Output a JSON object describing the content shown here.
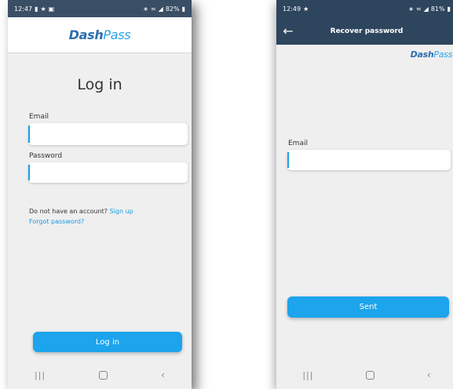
{
  "left_screen": {
    "status": {
      "time": "12:47",
      "battery": "82%"
    },
    "logo": {
      "dash": "Dash",
      "pass": "Pass"
    },
    "title": "Log in",
    "email": {
      "label": "Email",
      "value": ""
    },
    "password": {
      "label": "Password",
      "value": ""
    },
    "no_account_text": "Do not have an account?",
    "sign_up_link": "Sign up",
    "forgot_link": "Forgot password?",
    "login_button": "Log in"
  },
  "right_screen": {
    "status": {
      "time": "12:49",
      "battery": "81%"
    },
    "header_title": "Recover password",
    "logo": {
      "dash": "Dash",
      "pass": "Pass"
    },
    "email": {
      "label": "Email",
      "value": ""
    },
    "sent_button": "Sent"
  },
  "colors": {
    "accent": "#1ca4ec",
    "header": "#2e455e",
    "logo_blue": "#2c6fb0"
  }
}
